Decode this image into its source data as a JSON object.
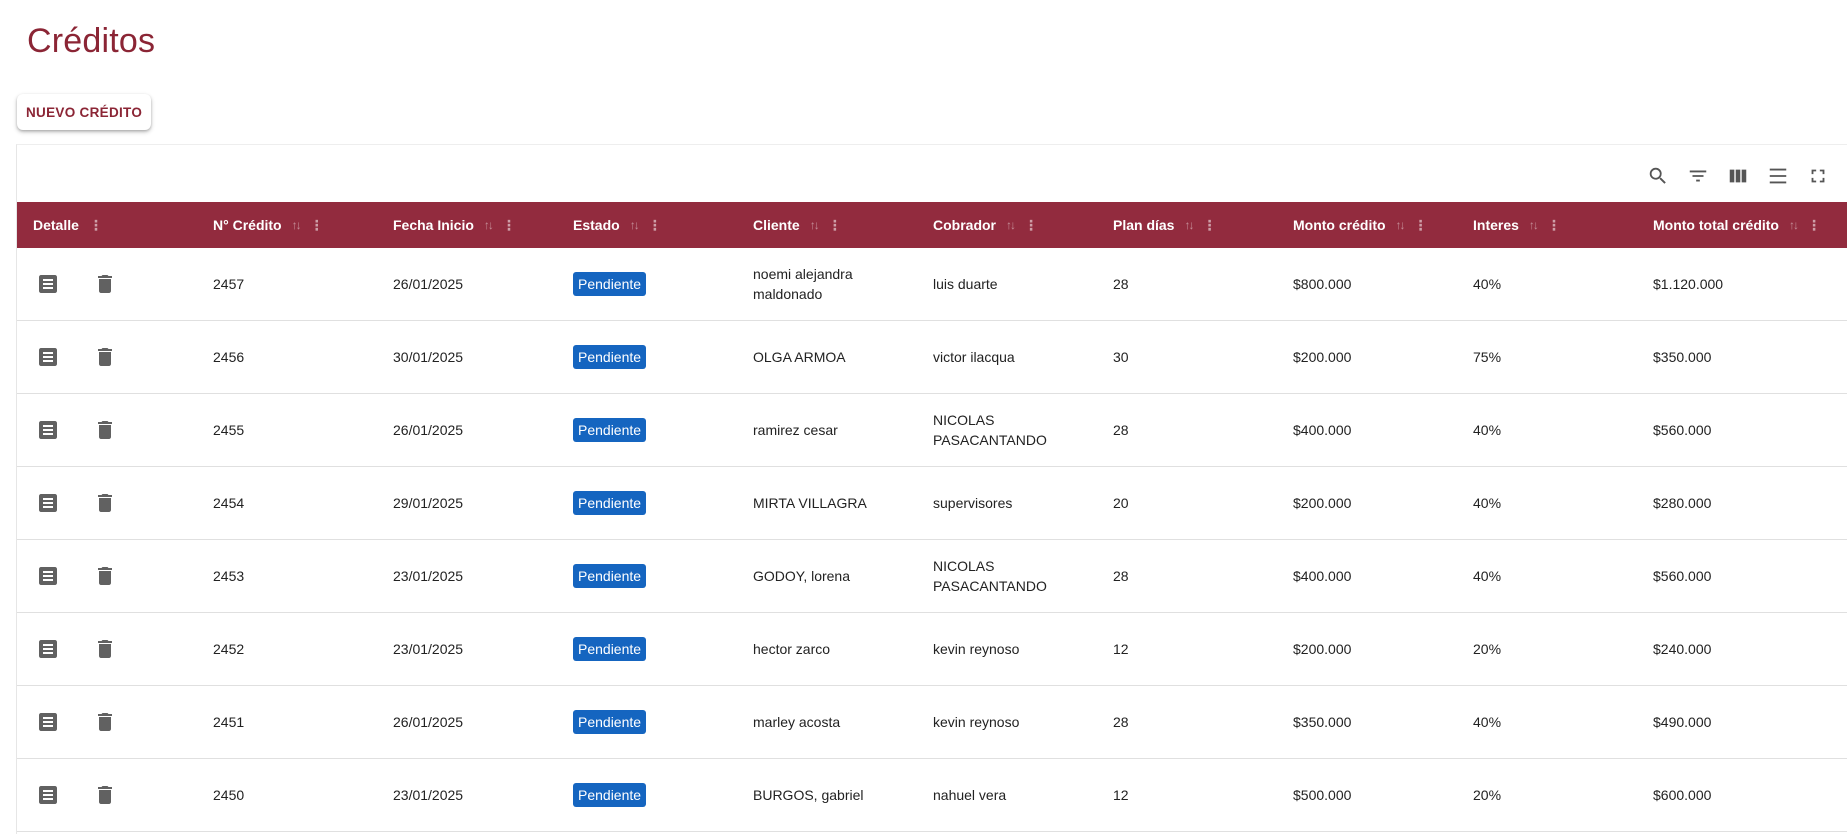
{
  "page": {
    "title": "Créditos",
    "new_button": "NUEVO CRÉDITO"
  },
  "toolbar": [
    "search-icon",
    "filter-icon",
    "columns-icon",
    "density-icon",
    "fullscreen-icon"
  ],
  "columns": [
    {
      "key": "detalle",
      "label": "Detalle"
    },
    {
      "key": "numero",
      "label": "N° Crédito"
    },
    {
      "key": "fecha",
      "label": "Fecha Inicio"
    },
    {
      "key": "estado",
      "label": "Estado"
    },
    {
      "key": "cliente",
      "label": "Cliente"
    },
    {
      "key": "cobrador",
      "label": "Cobrador"
    },
    {
      "key": "plan",
      "label": "Plan días"
    },
    {
      "key": "monto",
      "label": "Monto crédito"
    },
    {
      "key": "interes",
      "label": "Interes"
    },
    {
      "key": "total",
      "label": "Monto total crédito"
    }
  ],
  "rows": [
    {
      "numero": "2457",
      "fecha": "26/01/2025",
      "estado": "Pendiente",
      "cliente": "noemi alejandra maldonado",
      "cobrador": "luis duarte",
      "plan": "28",
      "monto": "$800.000",
      "interes": "40%",
      "total": "$1.120.000"
    },
    {
      "numero": "2456",
      "fecha": "30/01/2025",
      "estado": "Pendiente",
      "cliente": "OLGA ARMOA",
      "cobrador": "victor ilacqua",
      "plan": "30",
      "monto": "$200.000",
      "interes": "75%",
      "total": "$350.000"
    },
    {
      "numero": "2455",
      "fecha": "26/01/2025",
      "estado": "Pendiente",
      "cliente": "ramirez cesar",
      "cobrador": "NICOLAS PASACANTANDO",
      "plan": "28",
      "monto": "$400.000",
      "interes": "40%",
      "total": "$560.000"
    },
    {
      "numero": "2454",
      "fecha": "29/01/2025",
      "estado": "Pendiente",
      "cliente": "MIRTA VILLAGRA",
      "cobrador": "supervisores",
      "plan": "20",
      "monto": "$200.000",
      "interes": "40%",
      "total": "$280.000"
    },
    {
      "numero": "2453",
      "fecha": "23/01/2025",
      "estado": "Pendiente",
      "cliente": "GODOY, lorena",
      "cobrador": "NICOLAS PASACANTANDO",
      "plan": "28",
      "monto": "$400.000",
      "interes": "40%",
      "total": "$560.000"
    },
    {
      "numero": "2452",
      "fecha": "23/01/2025",
      "estado": "Pendiente",
      "cliente": "hector zarco",
      "cobrador": "kevin reynoso",
      "plan": "12",
      "monto": "$200.000",
      "interes": "20%",
      "total": "$240.000"
    },
    {
      "numero": "2451",
      "fecha": "26/01/2025",
      "estado": "Pendiente",
      "cliente": "marley acosta",
      "cobrador": "kevin reynoso",
      "plan": "28",
      "monto": "$350.000",
      "interes": "40%",
      "total": "$490.000"
    },
    {
      "numero": "2450",
      "fecha": "23/01/2025",
      "estado": "Pendiente",
      "cliente": "BURGOS, gabriel",
      "cobrador": "nahuel vera",
      "plan": "12",
      "monto": "$500.000",
      "interes": "20%",
      "total": "$600.000"
    }
  ],
  "colors": {
    "accent": "#8b2535",
    "header_bg": "#922b3e",
    "badge_bg": "#1565c0"
  }
}
